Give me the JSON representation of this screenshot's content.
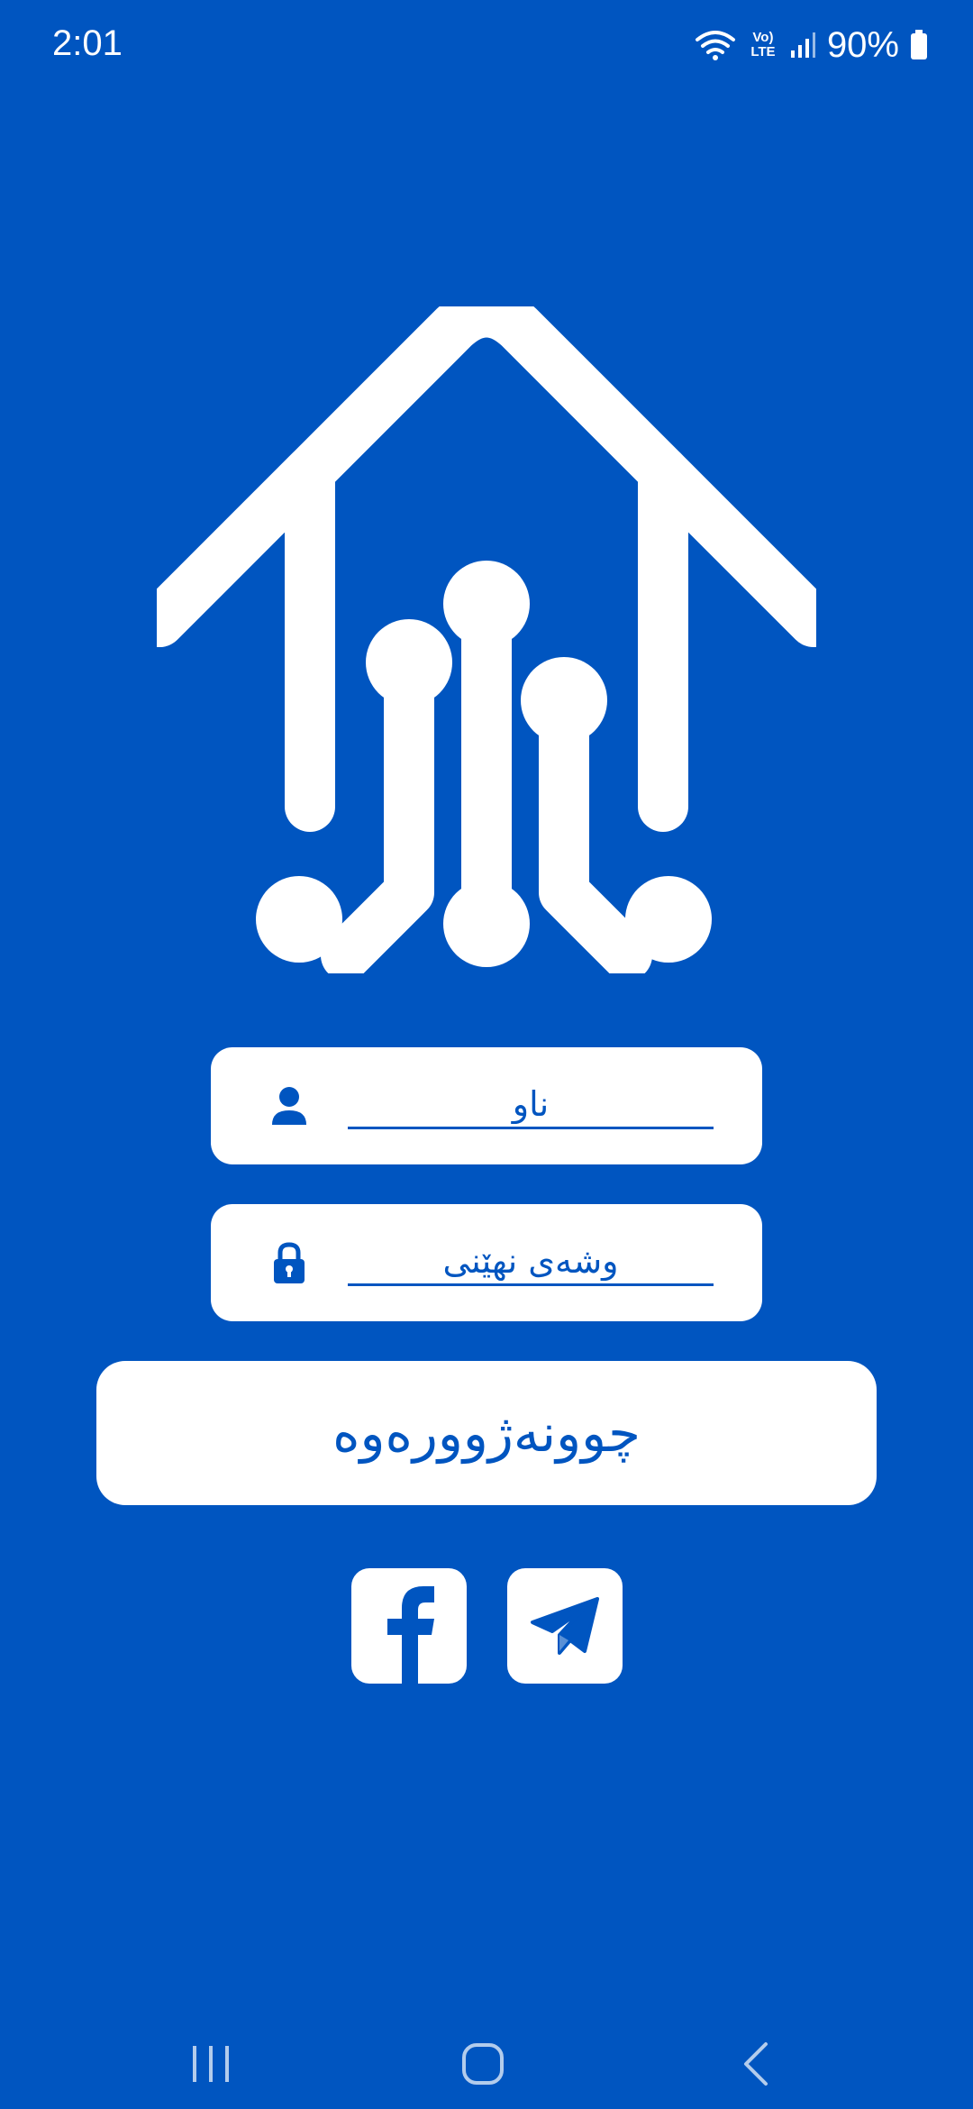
{
  "status_bar": {
    "time": "2:01",
    "network_label": "Vo) LTE",
    "battery": "90%"
  },
  "login_form": {
    "username_placeholder": "ناو",
    "password_placeholder": "وشەی نهێنی",
    "login_label": "چوونەژوورەوە"
  },
  "social": {
    "items": [
      "facebook",
      "telegram"
    ]
  },
  "nav": {
    "items": [
      "recents",
      "home",
      "back"
    ]
  },
  "colors": {
    "background": "#0055C0",
    "surface": "#FFFFFF",
    "accent": "#0055C0"
  }
}
